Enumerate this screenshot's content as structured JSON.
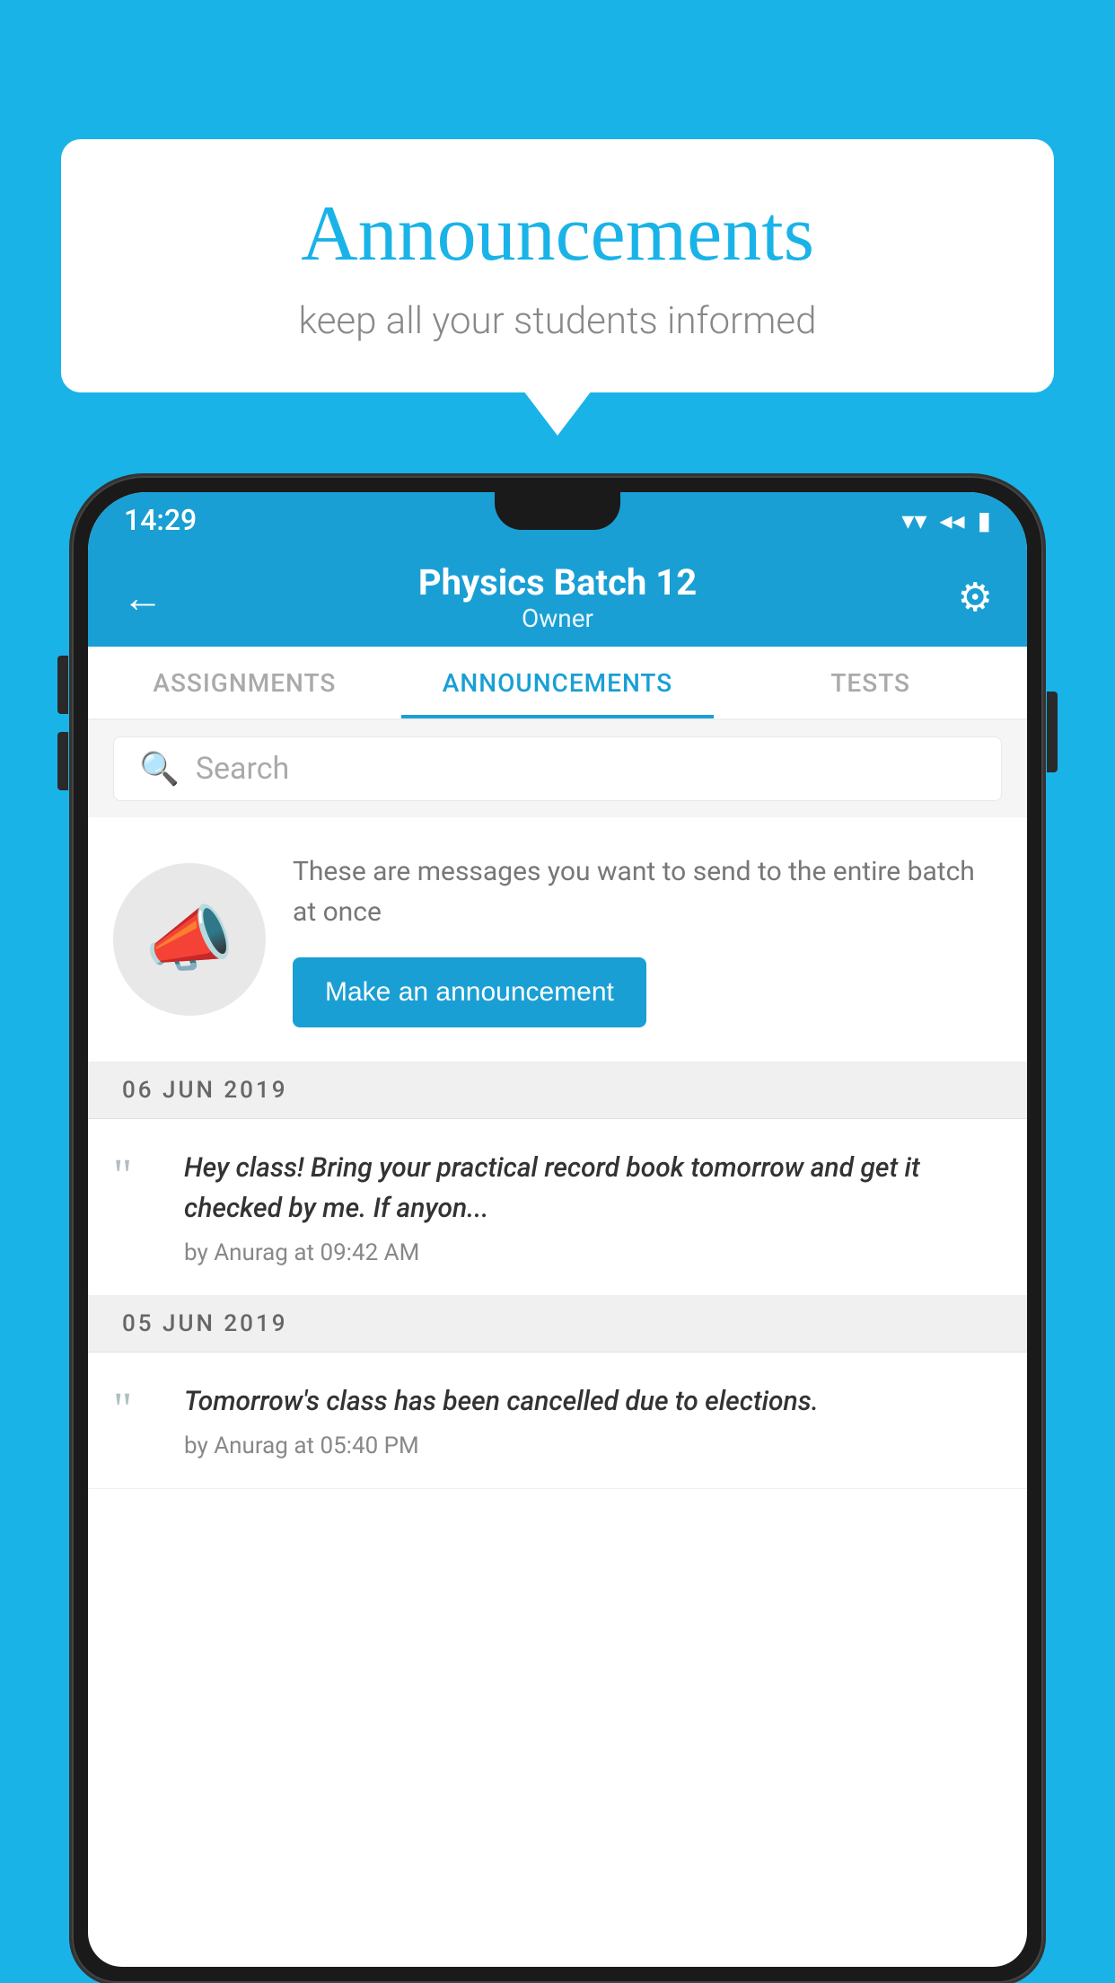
{
  "page": {
    "background_color": "#1ab3e8"
  },
  "speech_bubble": {
    "title": "Announcements",
    "subtitle": "keep all your students informed"
  },
  "phone": {
    "status_bar": {
      "time": "14:29",
      "wifi": "▼",
      "signal": "▲",
      "battery": "▮"
    },
    "app_bar": {
      "back_label": "←",
      "title": "Physics Batch 12",
      "subtitle": "Owner",
      "settings_label": "⚙"
    },
    "tabs": [
      {
        "label": "ASSIGNMENTS",
        "active": false
      },
      {
        "label": "ANNOUNCEMENTS",
        "active": true
      },
      {
        "label": "TESTS",
        "active": false
      }
    ],
    "search": {
      "placeholder": "Search"
    },
    "announcement_empty": {
      "description_text": "These are messages you want to send to the entire batch at once",
      "button_label": "Make an announcement"
    },
    "announcements": [
      {
        "date": "06  JUN  2019",
        "message": "Hey class! Bring your practical record book tomorrow and get it checked by me. If anyon...",
        "meta": "by Anurag at 09:42 AM"
      },
      {
        "date": "05  JUN  2019",
        "message": "Tomorrow's class has been cancelled due to elections.",
        "meta": "by Anurag at 05:40 PM"
      }
    ]
  }
}
